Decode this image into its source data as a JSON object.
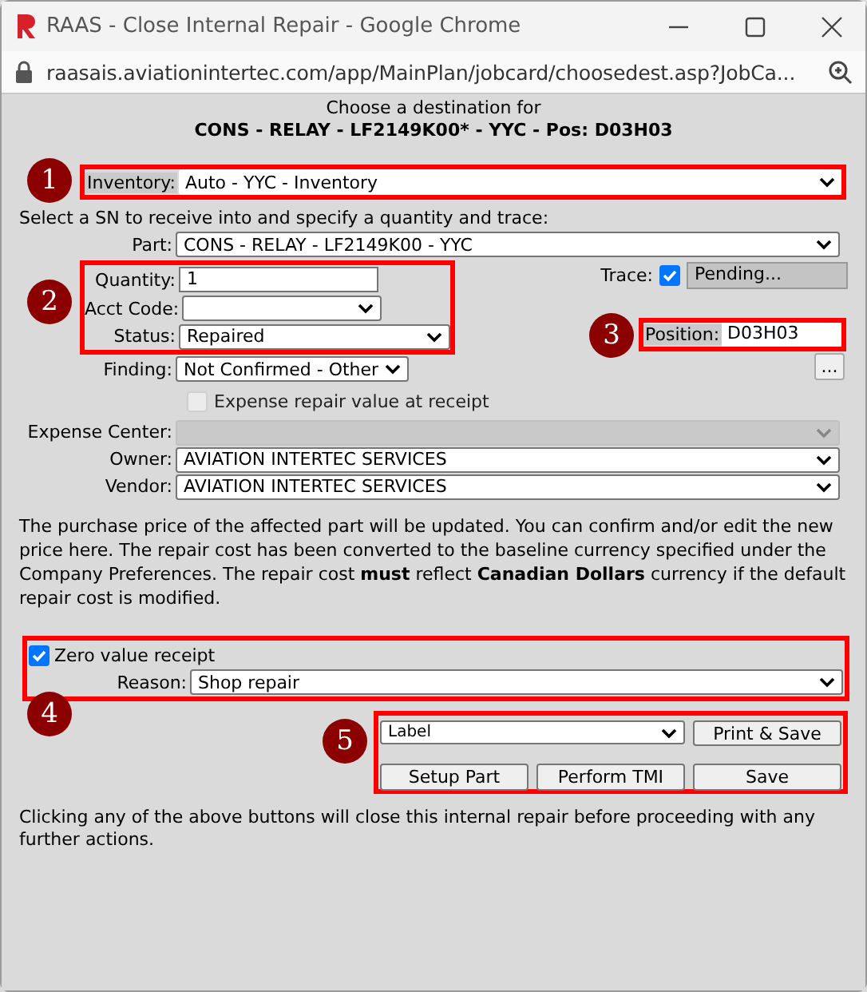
{
  "window": {
    "title": "RAAS - Close Internal Repair - Google Chrome"
  },
  "address_bar": {
    "url": "raasais.aviationintertec.com/app/MainPlan/jobcard/choosedest.asp?JobCa..."
  },
  "heading": {
    "line_1": "Choose a destination for",
    "line_2": "CONS - RELAY - LF2149K00* - YYC - Pos: D03H03"
  },
  "inventory": {
    "callout": "1",
    "label": "Inventory:",
    "value": "Auto - YYC - Inventory"
  },
  "instruction": "Select a SN to receive into and specify a quantity and trace:",
  "part": {
    "label": "Part:",
    "value": "CONS - RELAY - LF2149K00 - YYC"
  },
  "receipt_fields": {
    "callout": "2",
    "fields": [
      {
        "kind": "text",
        "label": "Quantity:",
        "value": "1"
      },
      {
        "kind": "select",
        "label": "Acct Code:"
      },
      {
        "kind": "select",
        "label": "Status:",
        "value": "Repaired"
      }
    ]
  },
  "trace": {
    "label": "Trace:",
    "checked": true,
    "value": "Pending..."
  },
  "position": {
    "callout": "3",
    "label": "Position:",
    "value": "D03H03"
  },
  "finding": {
    "label": "Finding:",
    "value": "Not Confirmed - Other"
  },
  "more_button": "...",
  "expense_repair": {
    "label": "Expense repair value at receipt",
    "checked": false,
    "disabled": true
  },
  "accounts": [
    {
      "label": "Expense Center:",
      "disabled": true
    },
    {
      "label": "Owner:",
      "value": "AVIATION INTERTEC SERVICES",
      "disabled": false
    },
    {
      "label": "Vendor:",
      "value": "AVIATION INTERTEC SERVICES",
      "disabled": false
    }
  ],
  "notice": "The purchase price of the affected part will be updated. You can confirm and/or edit the new price here. The repair cost has been converted to the baseline currency specified under the Company Preferences. The repair cost **must** reflect **Canadian Dollars** currency if the default repair cost is modified.",
  "zero_value": {
    "callout": "4",
    "label": "Zero value receipt",
    "checked": true,
    "reason_label": "Reason:",
    "reason": "Shop repair"
  },
  "actions": {
    "callout": "5",
    "print_format": "Label",
    "buttons": [
      "Print & Save",
      "Setup Part",
      "Perform TMI",
      "Save"
    ]
  },
  "footer_note": "Clicking any of the above buttons will close this internal repair before proceeding with any further actions."
}
